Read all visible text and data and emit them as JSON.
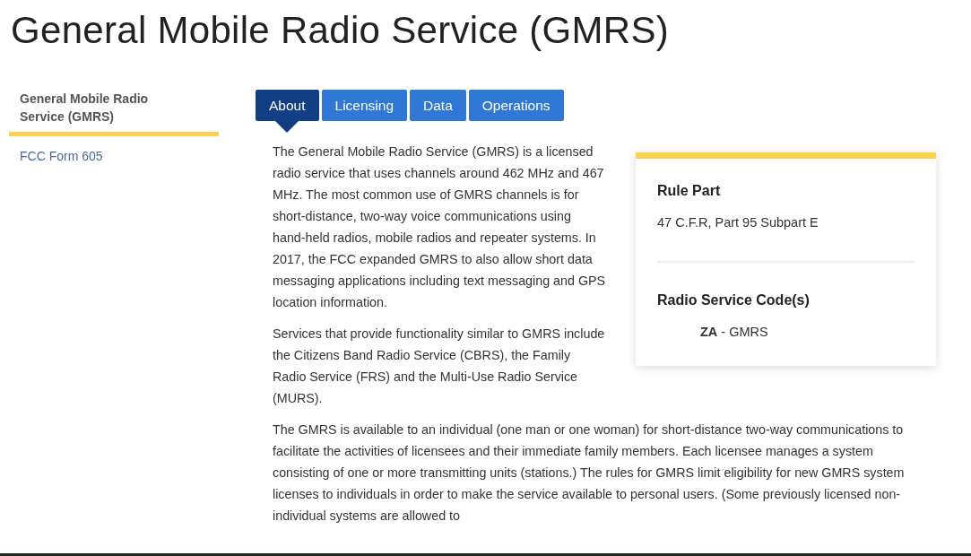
{
  "page_title": "General Mobile Radio Service (GMRS)",
  "sidebar": {
    "items": [
      {
        "label": "General Mobile Radio Service (GMRS)",
        "selected": true
      },
      {
        "label": "FCC Form 605",
        "selected": false
      }
    ]
  },
  "tabs": [
    {
      "label": "About",
      "selected": true
    },
    {
      "label": "Licensing",
      "selected": false
    },
    {
      "label": "Data",
      "selected": false
    },
    {
      "label": "Operations",
      "selected": false
    }
  ],
  "info_card": {
    "sections": [
      {
        "heading": "Rule Part",
        "value": "47 C.F.R, Part 95 Subpart E",
        "indented": false
      },
      {
        "heading": "Radio Service Code(s)",
        "value": "**ZA** - GMRS",
        "indented": true
      }
    ]
  },
  "paragraphs": [
    "The General Mobile Radio Service (GMRS) is a licensed radio service that uses channels around 462 MHz and 467 MHz. The most common use of GMRS channels is for short-distance, two-way voice communications using hand-held radios, mobile radios and repeater systems. In 2017, the FCC expanded GMRS to also allow short data messaging applications including text messaging and GPS location information.",
    "Services that provide functionality similar to GMRS include the Citizens Band Radio Service (CBRS), the Family Radio Service (FRS) and the Multi-Use Radio Service (MURS).",
    "The GMRS is available to an individual (one man or one woman) for short-distance two-way communications to facilitate the activities of licensees and their immediate family members. Each licensee manages a system consisting of one or more transmitting units (stations.) The rules for GMRS limit eligibility for new GMRS system licenses to individuals in order to make the service available to personal users. (Some previously licensed non-individual systems are allowed to"
  ]
}
